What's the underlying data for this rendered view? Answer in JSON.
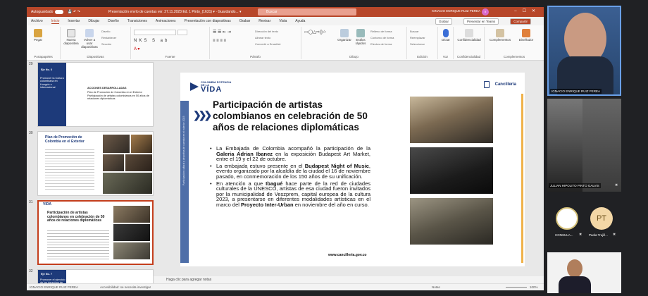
{
  "window": {
    "autosave": "Autoguardado",
    "doc_title": "Presentación envío de cuentas ver. 27.11.2023 Ed. 1 Pinto_(1631) ▾ · Guardando... ▾",
    "search": "Buscar",
    "user": "IGNACIO ENRIQUE RUIZ PEREA",
    "user_initials": "II"
  },
  "menu": {
    "tabs": [
      "Archivo",
      "Inicio",
      "Insertar",
      "Dibujar",
      "Diseño",
      "Transiciones",
      "Animaciones",
      "Presentación con diapositivas",
      "Grabar",
      "Revisar",
      "Vista",
      "Ayuda"
    ],
    "grabar": "Grabar",
    "presentar": "Presentar en Teams",
    "compartir": "Compartir"
  },
  "ribbon": {
    "groups": [
      "Portapapeles",
      "Diapositivas",
      "Fuente",
      "Párrafo",
      "Dibujo",
      "Edición",
      "Voz",
      "Confidencialidad",
      "Complementos"
    ],
    "paste": "Pegar",
    "new_slide": "Nueva diapositiva",
    "reuse": "Volver a usar diapositivas",
    "design": "Diseño",
    "reset": "Restablecer",
    "section": "Sección",
    "direction": "Dirección del texto",
    "align": "Alinear texto",
    "convert": "Convertir a SmartArt",
    "organize": "Organizar",
    "styles": "Estilos rápidos",
    "fill": "Relleno de forma",
    "outline": "Contorno de forma",
    "effects": "Efectos de forma",
    "find": "Buscar",
    "replace": "Reemplazar",
    "select": "Seleccionar",
    "dictate": "Dictar",
    "sensitivity": "Confidencialidad",
    "addins": "Complementos",
    "designer": "Diseñador"
  },
  "thumbs": [
    {
      "num": "29",
      "title": "Eje No. 6",
      "subtitle": "Promover la Cultura colombiana en Hungría e internacional",
      "heading": "ACCIONES DESARROLLADAS",
      "items": [
        "Plan de Promoción de Colombia en el Exterior",
        "Participación de artistas colombianos en 50 años de relaciones diplomáticas"
      ]
    },
    {
      "num": "30",
      "title": "Plan de Promoción de Colombia en el Exterior"
    },
    {
      "num": "31",
      "title": "Participación de artistas colombianos en celebración de 50 años de relaciones diplomáticas"
    },
    {
      "num": "32",
      "title": "Eje No. 7",
      "subtitle": "Promover el ejercicio de los derechos de los colombianos"
    }
  ],
  "slide": {
    "brand_small": "COLOMBIA POTENCIA DE LA",
    "brand_big": "VIDA",
    "cancilleria": "Cancillería",
    "side_text": "Participación cultural y deportiva de cuentas en el exterior 2023",
    "title": "Participación de artistas colombianos en celebración de 50 años de relaciones diplomáticas",
    "b1_pre": "La Embajada de Colombia acompañó la participación de la ",
    "b1_bold": "Galeria Adrian Ibanez",
    "b1_post": " en la exposición Budapest Art Market, entre el 19 y el 22 de octubre.",
    "b2_pre": "La embajada estuvo presente en el ",
    "b2_bold": "Budapest Night of Music",
    "b2_post": ", evento organizado por la alcaldía de la ciudad el 16 de noviembre pasado, en conmemoración de los 150 años de su unificación.",
    "b3_pre": "En atención a que ",
    "b3_bold1": "Ibagué",
    "b3_mid": " hace parte de la red de ciudades culturales de la UNESCO, artistas de esa ciudad fueron invitados por la municipalidad de Veszprem, capital europea de la cultura 2023, a presentarse en diferentes modalidades artísticas en el marco del ",
    "b3_bold2": "Proyecto Inter-Urban",
    "b3_post": " en noviembre del año en curso.",
    "url": "www.cancilleria.gov.co"
  },
  "notes": "Haga clic para agregar notas",
  "status": {
    "left": "IGNACIO ENRIQUE RUIZ PEREA",
    "access": "Accesibilidad: se necesita investigar",
    "notes": "Notas",
    "zoom": "100%"
  },
  "participants": {
    "p1": "IGNACIO ENRIQUE RUIZ PEREA",
    "p2": "JULIAN HIPOLITO PINTO GALVIS",
    "p3": "CONSULA...",
    "p4_initials": "PT",
    "p4": "Paola Trujill..."
  }
}
